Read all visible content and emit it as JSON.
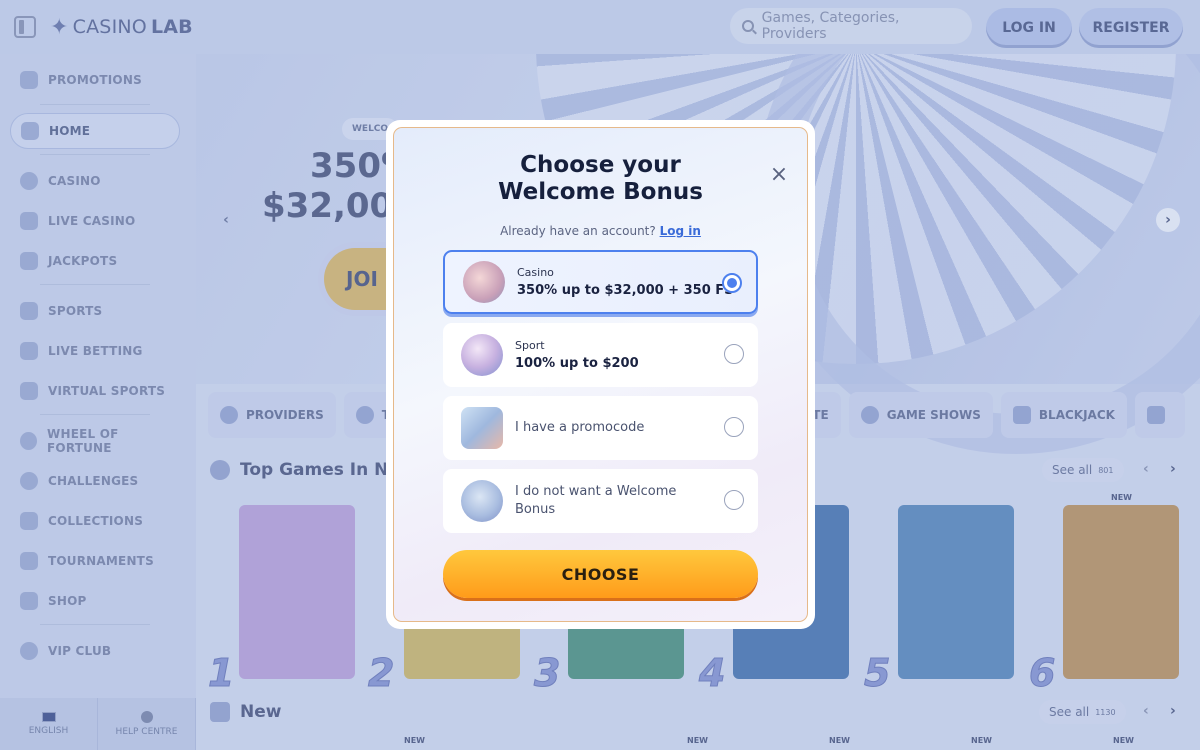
{
  "header": {
    "brand_light": "CASINO",
    "brand_bold": "LAB",
    "search_placeholder": "Games, Categories, Providers",
    "login_label": "LOG IN",
    "register_label": "REGISTER"
  },
  "sidebar": {
    "items": [
      {
        "label": "PROMOTIONS",
        "icon": "promotions-icon"
      },
      {
        "label": "HOME",
        "icon": "home-icon",
        "active": true
      },
      {
        "label": "CASINO",
        "icon": "casino-icon"
      },
      {
        "label": "LIVE CASINO",
        "icon": "live-casino-icon"
      },
      {
        "label": "JACKPOTS",
        "icon": "jackpots-icon"
      },
      {
        "label": "SPORTS",
        "icon": "sports-icon"
      },
      {
        "label": "LIVE BETTING",
        "icon": "live-betting-icon"
      },
      {
        "label": "VIRTUAL SPORTS",
        "icon": "virtual-sports-icon"
      },
      {
        "label": "WHEEL OF FORTUNE",
        "icon": "wheel-icon"
      },
      {
        "label": "CHALLENGES",
        "icon": "challenges-icon"
      },
      {
        "label": "COLLECTIONS",
        "icon": "collections-icon"
      },
      {
        "label": "TOURNAMENTS",
        "icon": "trophy-icon"
      },
      {
        "label": "SHOP",
        "icon": "shop-icon"
      },
      {
        "label": "VIP CLUB",
        "icon": "vip-icon"
      }
    ],
    "footer": {
      "language": "ENGLISH",
      "help": "HELP CENTRE"
    }
  },
  "hero": {
    "pill": "WELCO",
    "line1": "350%",
    "line2": "$32,000",
    "join": "JOI"
  },
  "categories": [
    "PROVIDERS",
    "TO",
    "LETTE",
    "GAME SHOWS",
    "BLACKJACK"
  ],
  "sections": {
    "top": {
      "title": "Top Games In Ne",
      "see_all": "See all",
      "count": "801"
    },
    "new": {
      "title": "New",
      "see_all": "See all",
      "count": "1130"
    }
  },
  "games": {
    "ranks": [
      "1",
      "2",
      "3",
      "4",
      "5",
      "6"
    ],
    "new_tag": "NEW",
    "colors": [
      "#b59ad6",
      "#c9b25a",
      "#3f8a74",
      "#3a6aa8",
      "#4b7fb5",
      "#b6894f"
    ]
  },
  "modal": {
    "title_line1": "Choose your",
    "title_line2": "Welcome Bonus",
    "subtitle": "Already have an account?",
    "login_link": "Log in",
    "options": [
      {
        "label": "Casino",
        "value": "350% up to $32,000 + 350 FS",
        "selected": true
      },
      {
        "label": "Sport",
        "value": "100% up to $200",
        "selected": false
      },
      {
        "label": "I have a promocode",
        "selected": false
      },
      {
        "label": "I do not want a Welcome Bonus",
        "selected": false
      }
    ],
    "button": "CHOOSE"
  },
  "colors": {
    "accent_blue": "#4d80ee",
    "button_orange": "#ff9b1a",
    "link_blue": "#3a6bd8"
  }
}
